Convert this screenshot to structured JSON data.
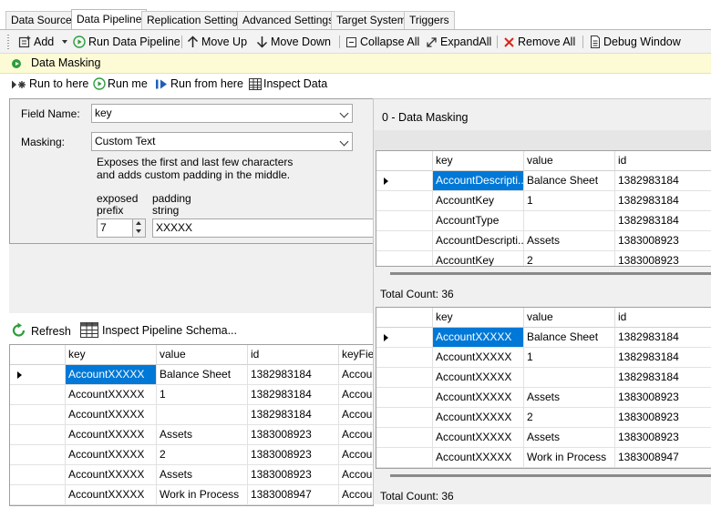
{
  "tabs": [
    {
      "label": "Data Source",
      "active": false
    },
    {
      "label": "Data Pipeline",
      "active": true
    },
    {
      "label": "Replication Settings",
      "active": false
    },
    {
      "label": "Advanced Settings",
      "active": false
    },
    {
      "label": "Target System",
      "active": false
    },
    {
      "label": "Triggers",
      "active": false
    }
  ],
  "toolbar": {
    "add": "Add",
    "run_pipeline": "Run Data Pipeline",
    "move_up": "Move Up",
    "move_down": "Move Down",
    "collapse_all": "Collapse All",
    "expand_all": "ExpandAll",
    "remove_all": "Remove All",
    "debug_window": "Debug Window"
  },
  "step": {
    "label": "Data Masking"
  },
  "runbar": {
    "run_to_here": "Run to here",
    "run_me": "Run me",
    "run_from_here": "Run from here",
    "inspect_data": "Inspect Data"
  },
  "settings": {
    "field_name_label": "Field Name:",
    "field_name_value": "key",
    "masking_label": "Masking:",
    "masking_value": "Custom Text",
    "description_line1": "Exposes the first and last few characters",
    "description_line2": "and adds custom padding in the middle.",
    "exposed_prefix_label_1": "exposed",
    "exposed_prefix_label_2": "prefix",
    "exposed_prefix_value": "7",
    "padding_label_1": "padding",
    "padding_label_2": "string",
    "padding_value": "XXXXX"
  },
  "bottombar": {
    "refresh": "Refresh",
    "inspect_schema": "Inspect Pipeline Schema..."
  },
  "left_grid": {
    "columns": [
      "key",
      "value",
      "id",
      "keyFie"
    ],
    "rows": [
      [
        "AccountXXXXX",
        "Balance Sheet",
        "1382983184",
        "Accour"
      ],
      [
        "AccountXXXXX",
        "1",
        "1382983184",
        "Accour"
      ],
      [
        "AccountXXXXX",
        "",
        "1382983184",
        "Accour"
      ],
      [
        "AccountXXXXX",
        "Assets",
        "1383008923",
        "Accour"
      ],
      [
        "AccountXXXXX",
        "2",
        "1383008923",
        "Accour"
      ],
      [
        "AccountXXXXX",
        "Assets",
        "1383008923",
        "Accour"
      ],
      [
        "AccountXXXXX",
        "Work in Process",
        "1383008947",
        "Accour"
      ]
    ]
  },
  "right_panel": {
    "title": "0 - Data Masking",
    "top_grid": {
      "columns": [
        "key",
        "value",
        "id"
      ],
      "rows": [
        [
          "AccountDescripti...",
          "Balance Sheet",
          "1382983184"
        ],
        [
          "AccountKey",
          "1",
          "1382983184"
        ],
        [
          "AccountType",
          "",
          "1382983184"
        ],
        [
          "AccountDescripti...",
          "Assets",
          "1383008923"
        ],
        [
          "AccountKey",
          "2",
          "1383008923"
        ]
      ],
      "total": "Total Count: 36"
    },
    "bottom_grid": {
      "columns": [
        "key",
        "value",
        "id"
      ],
      "rows": [
        [
          "AccountXXXXX",
          "Balance Sheet",
          "1382983184"
        ],
        [
          "AccountXXXXX",
          "1",
          "1382983184"
        ],
        [
          "AccountXXXXX",
          "",
          "1382983184"
        ],
        [
          "AccountXXXXX",
          "Assets",
          "1383008923"
        ],
        [
          "AccountXXXXX",
          "2",
          "1383008923"
        ],
        [
          "AccountXXXXX",
          "Assets",
          "1383008923"
        ],
        [
          "AccountXXXXX",
          "Work in Process",
          "1383008947"
        ]
      ],
      "total": "Total Count: 36"
    }
  },
  "colors": {
    "selection": "#0078d7",
    "step_bar": "#fdfbd6",
    "run_green": "#2e9e3e",
    "remove_red": "#d9261c"
  }
}
